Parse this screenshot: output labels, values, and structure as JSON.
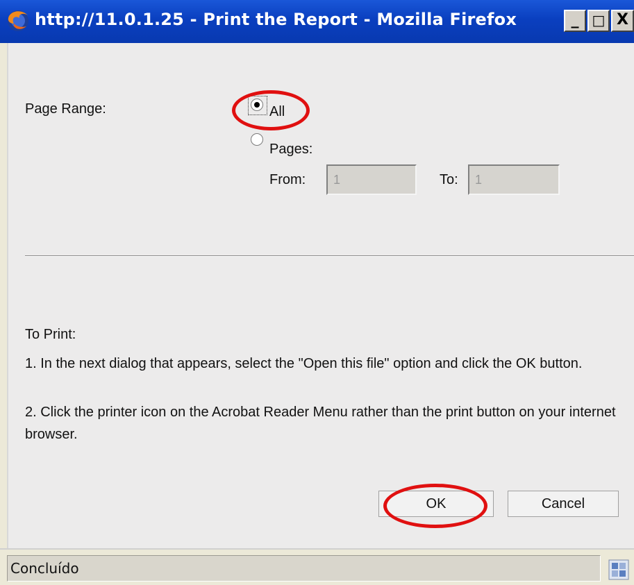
{
  "window": {
    "title": "http://11.0.1.25 - Print the Report - Mozilla Firefox",
    "minimize_label": "_",
    "maximize_label": "□",
    "close_label": "X"
  },
  "form": {
    "page_range_label": "Page Range:",
    "option_all_label": "All",
    "option_pages_label": "Pages:",
    "selected_option": "All",
    "from_label": "From:",
    "from_value": "1",
    "to_label": "To:",
    "to_value": "1"
  },
  "instructions": {
    "heading": "To Print:",
    "step1": "1. In the next dialog that appears, select the \"Open this file\" option and click the OK button.",
    "step2": "2. Click the printer icon on the Acrobat Reader Menu rather than the print button on your internet browser."
  },
  "buttons": {
    "ok_label": "OK",
    "cancel_label": "Cancel"
  },
  "statusbar": {
    "text": "Concluído"
  },
  "icons": {
    "app": "firefox-icon",
    "status": "page-info-icon"
  },
  "colors": {
    "titlebar": "#0a3fbf",
    "highlight_ring": "#e01010",
    "background": "#ecebeb"
  }
}
